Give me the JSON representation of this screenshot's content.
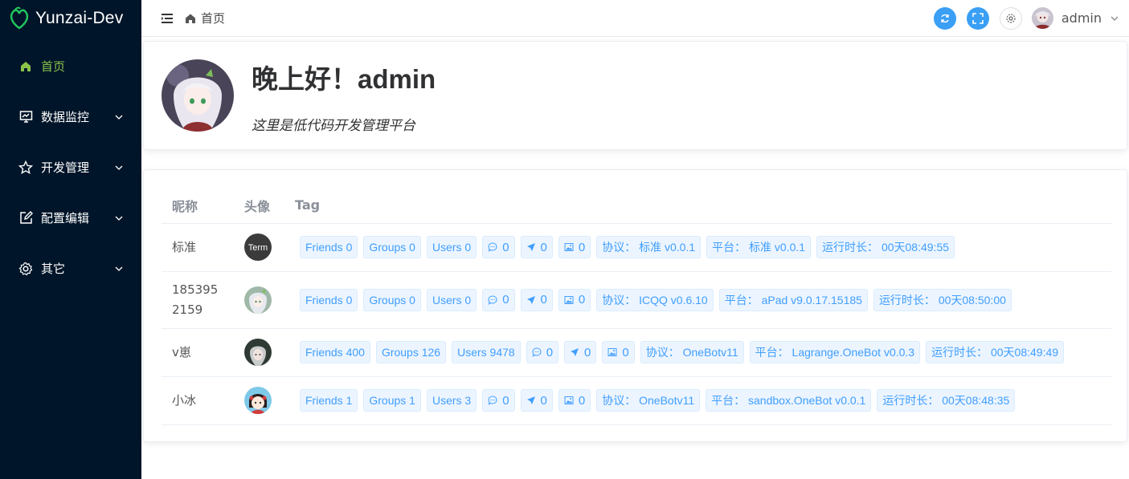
{
  "app": {
    "title": "Yunzai-Dev"
  },
  "sidebar": {
    "items": [
      {
        "label": "首页",
        "icon": "home-icon",
        "active": true
      },
      {
        "label": "数据监控",
        "icon": "monitor-icon"
      },
      {
        "label": "开发管理",
        "icon": "star-icon"
      },
      {
        "label": "配置编辑",
        "icon": "edit-icon"
      },
      {
        "label": "其它",
        "icon": "gear-icon"
      }
    ]
  },
  "header": {
    "breadcrumb": "首页",
    "username": "admin"
  },
  "welcome": {
    "greeting": "晚上好！admin",
    "subtitle": "这里是低代码开发管理平台"
  },
  "table": {
    "headers": [
      "昵称",
      "头像",
      "Tag"
    ],
    "rows": [
      {
        "nick": "标准",
        "tags": [
          "Friends 0",
          "Groups 0",
          "Users 0"
        ],
        "counts": [
          "0",
          "0",
          "0"
        ],
        "protocol": "协议：  标准 v0.0.1",
        "platform": "平台：  标准 v0.0.1",
        "uptime": "运行时长：  00天08:49:55"
      },
      {
        "nick": "1853952159",
        "tags": [
          "Friends 0",
          "Groups 0",
          "Users 0"
        ],
        "counts": [
          "0",
          "0",
          "0"
        ],
        "protocol": "协议：  ICQQ v0.6.10",
        "platform": "平台：  aPad v9.0.17.15185",
        "uptime": "运行时长：  00天08:50:00"
      },
      {
        "nick": "v崽",
        "tags": [
          "Friends 400",
          "Groups 126",
          "Users 9478"
        ],
        "counts": [
          "0",
          "0",
          "0"
        ],
        "protocol": "协议：  OneBotv11",
        "platform": "平台：  Lagrange.OneBot v0.0.3",
        "uptime": "运行时长：  00天08:49:49"
      },
      {
        "nick": "小冰",
        "tags": [
          "Friends 1",
          "Groups 1",
          "Users 3"
        ],
        "counts": [
          "0",
          "0",
          "0"
        ],
        "protocol": "协议：  OneBotv11",
        "platform": "平台：  sandbox.OneBot v0.0.1",
        "uptime": "运行时长：  00天08:48:35"
      }
    ],
    "avatar_term_text": "Term"
  },
  "colors": {
    "sidebar_bg": "#001529",
    "accent": "#409eff",
    "active_menu": "#8bc34a",
    "header_btn": "#3a9ff5"
  }
}
